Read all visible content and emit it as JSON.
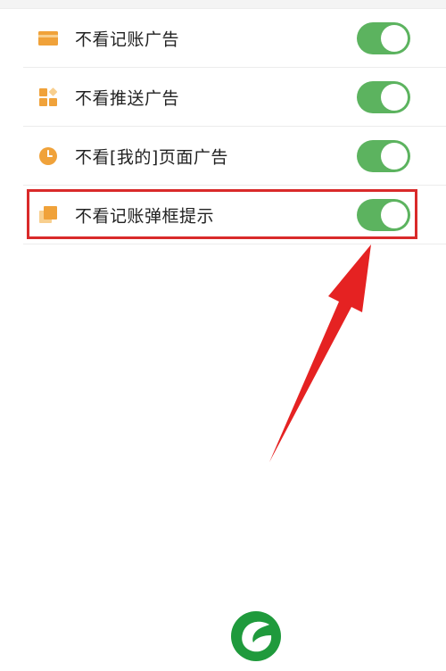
{
  "settings": {
    "items": [
      {
        "label": "不看记账广告",
        "icon": "card-icon",
        "enabled": true
      },
      {
        "label": "不看推送广告",
        "icon": "grid-icon",
        "enabled": true
      },
      {
        "label": "不看[我的]页面广告",
        "icon": "clock-icon",
        "enabled": true
      },
      {
        "label": "不看记账弹框提示",
        "icon": "popup-icon",
        "enabled": true
      }
    ]
  },
  "annotation": {
    "highlight_color": "#d92a2a",
    "arrow_color": "#e52222"
  },
  "colors": {
    "icon": "#f0a23a",
    "toggle_on": "#5cb35f",
    "logo": "#1f9a3c"
  }
}
